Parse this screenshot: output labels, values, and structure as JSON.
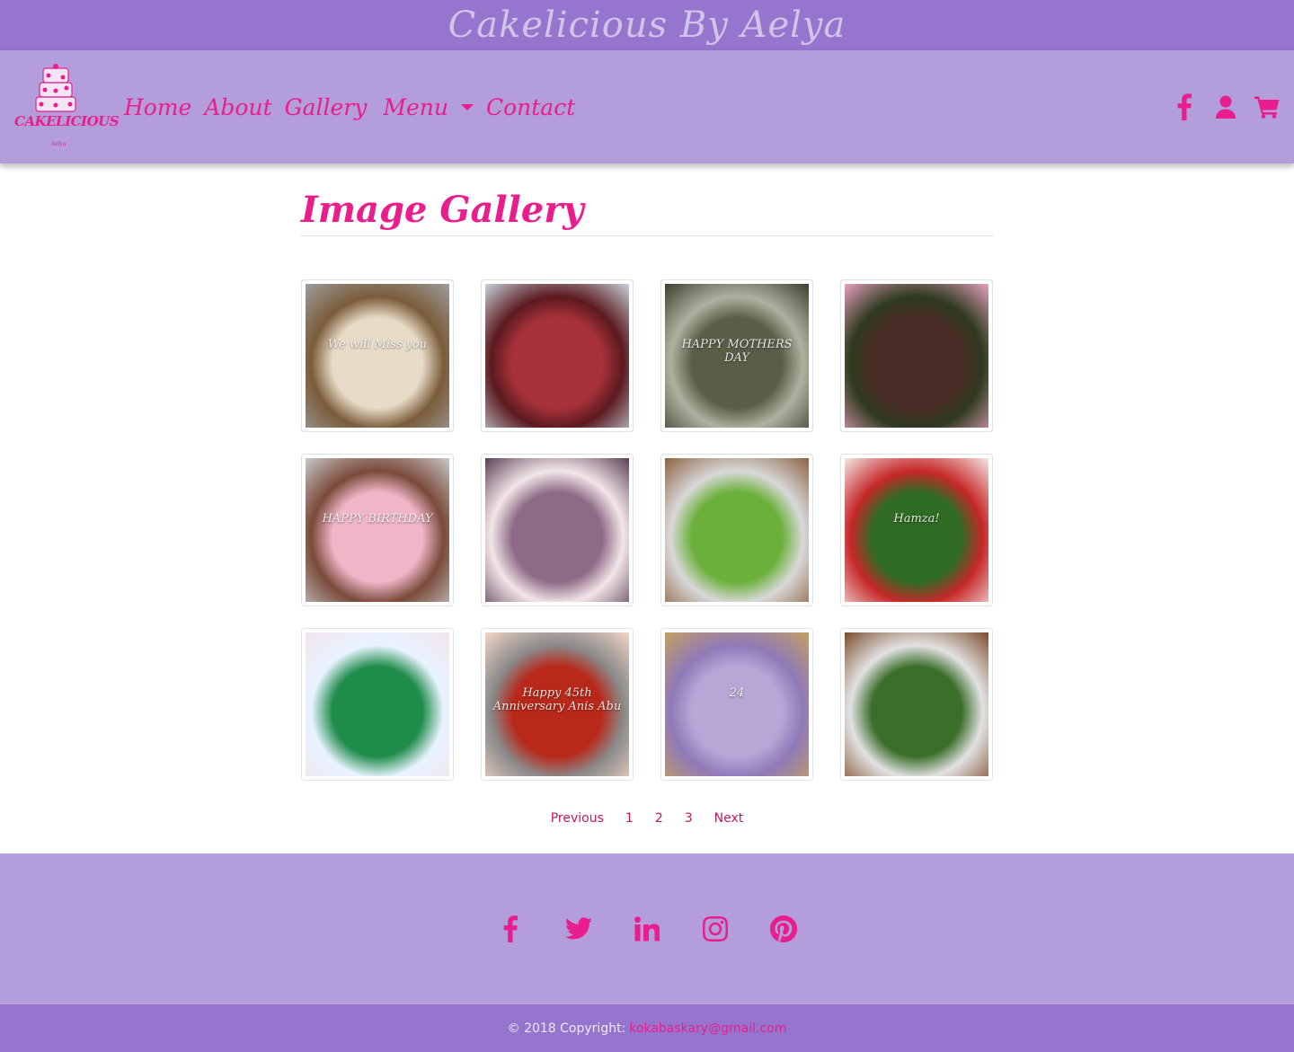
{
  "site": {
    "banner_title": "Cakelicious By Aelya",
    "logo_text": "CAKELICIOUS"
  },
  "nav": {
    "items": [
      {
        "label": "Home"
      },
      {
        "label": "About"
      },
      {
        "label": "Gallery"
      },
      {
        "label": "Menu",
        "dropdown": true
      },
      {
        "label": "Contact"
      }
    ],
    "icons": [
      "facebook-icon",
      "user-icon",
      "cart-icon"
    ]
  },
  "main": {
    "title": "Image Gallery",
    "gallery": [
      {
        "name": "cake-we-will-miss-you",
        "caption": "We will Miss you",
        "colors": [
          "#e8dcc8",
          "#9e9e9e",
          "#7a5c3a"
        ]
      },
      {
        "name": "cake-lightning-car",
        "caption": "",
        "colors": [
          "#a8323a",
          "#c9d4dc",
          "#5b1a1f"
        ]
      },
      {
        "name": "cake-handbag",
        "caption": "HAPPY MOTHERS DAY",
        "colors": [
          "#5a5e48",
          "#3a3e2c",
          "#b0b0a0"
        ]
      },
      {
        "name": "cake-owl",
        "caption": "",
        "colors": [
          "#4a2c26",
          "#e6a2c0",
          "#2e3a1e"
        ]
      },
      {
        "name": "cake-doc-mcstuffins",
        "caption": "HAPPY BIRTHDAY",
        "colors": [
          "#f0b6c8",
          "#c9c9c9",
          "#7a4a3a"
        ]
      },
      {
        "name": "cake-pillow-crown",
        "caption": "",
        "colors": [
          "#8e6a86",
          "#5a3e54",
          "#f2e6e8"
        ]
      },
      {
        "name": "cake-green-birthday",
        "caption": "",
        "colors": [
          "#6bb03a",
          "#8a6040",
          "#d8d8d8"
        ]
      },
      {
        "name": "cake-football-pitch",
        "caption": "Hamza!",
        "colors": [
          "#2f6b22",
          "#f4e8e8",
          "#c62828"
        ]
      },
      {
        "name": "cake-green-flowers",
        "caption": "",
        "colors": [
          "#1e8c4a",
          "#f3e5ec",
          "#e8f3ff"
        ]
      },
      {
        "name": "cake-anniversary",
        "caption": "Happy 45th Anniversary Anis Abu",
        "colors": [
          "#b8291a",
          "#f2d6c8",
          "#8a8a8a"
        ]
      },
      {
        "name": "cake-purple-24",
        "caption": "24",
        "colors": [
          "#b7a7d6",
          "#c5a060",
          "#8f7ab8"
        ]
      },
      {
        "name": "cake-angry-birds",
        "caption": "",
        "colors": [
          "#3b6e2a",
          "#7a4a2a",
          "#e2e2e2"
        ]
      }
    ]
  },
  "pagination": {
    "previous": "Previous",
    "pages": [
      "1",
      "2",
      "3"
    ],
    "next": "Next"
  },
  "footer": {
    "social": [
      "facebook-icon",
      "twitter-icon",
      "linkedin-icon",
      "instagram-icon",
      "pinterest-icon"
    ],
    "copyright_prefix": "© 2018 Copyright:",
    "email": "kokabaskary@gmail.com"
  },
  "colors": {
    "accent": "#e91e8c",
    "nav_bg": "#b39ddb",
    "banner_bg": "#9575cd"
  }
}
